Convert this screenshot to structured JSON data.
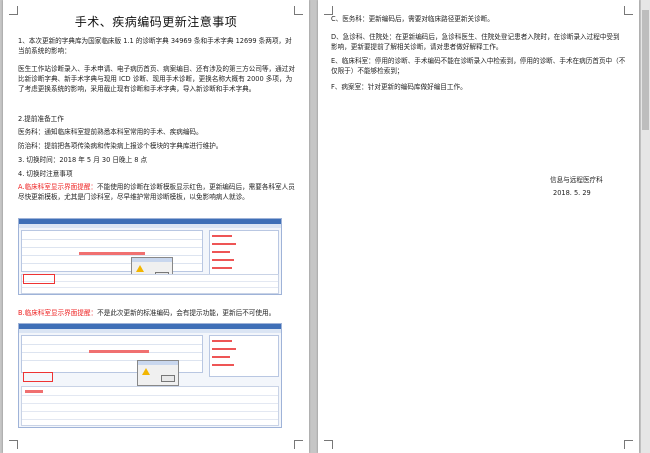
{
  "page1": {
    "title": "手术、疾病编码更新注意事项",
    "p1": "1、本次更新的字典库为国家临床版 1.1 的诊断字典 34969 条和手术字典 12699 条两项，对当前系统的影响：",
    "p2": "医生工作站诊断录入、手术申请、电子病历首页、病案编目、还有涉及的第三方公司等，通过对比新诊断字典、新手术字典与现用 ICD 诊断、现用手术诊断，更换名称大概有 2000 多项，为了考虑更换系统的影响，采用截止现有诊断和手术字典，导入新诊断和手术字典。",
    "p3": "2.提前准备工作",
    "p4": "医务科：通知临床科室提前熟悉本科室常用的手术、疾病编码。",
    "p5": "防治科：提前把各项传染病和传染病上报诊个模块的字典库进行维护。",
    "p6": "3.    切换时间：2018 年 5 月 30 日晚上 8 点",
    "p7": "4.    切换时注意事项",
    "p8_red": "A.临床科室显示界面提醒：",
    "p8_rest": "不能使用的诊断在诊断模板显示红色，更新编码后，需要各科室人员尽快更新模板，尤其是门诊科室，尽早维护常用诊断模板，以免影响病人就诊。",
    "p9_red": "B.临床科室显示界面提醒：",
    "p9_rest": "不是此次更新的标准编码，会有提示功能，更新后不可使用。"
  },
  "page2": {
    "c": "C、医务科：更新编码后，需要对临床路径更新关诊断。",
    "d": "D、急诊科、住院处：在更新编码后，急诊科医生、住院处登记患者入院时，在诊断录入过程中受到影响，更新要提前了解相关诊断，请对患者做好解释工作。",
    "e": "E、临床科室：停用的诊断、手术编码不能在诊断录入中检索到，停用的诊断、手术在病历首页中（不仅限于）不能够检索到；",
    "f": "F、病案室：针对更新的编码库做好编目工作。",
    "org": "信息与远程医疗科",
    "date": "2018. 5. 29"
  }
}
